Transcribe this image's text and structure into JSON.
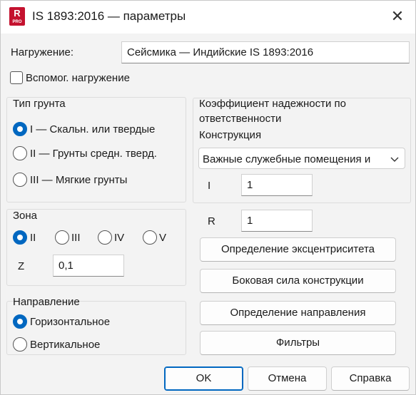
{
  "titlebar": {
    "app_icon_letter": "R",
    "app_icon_sub": "PRO",
    "title": "IS 1893:2016 — параметры",
    "close_symbol": "✕"
  },
  "load": {
    "label": "Нагружение:",
    "value": "Сейсмика — Индийские IS 1893:2016"
  },
  "aux_load": {
    "label": "Вспомог. нагружение",
    "checked": false
  },
  "soil": {
    "title": "Тип грунта",
    "options": [
      {
        "label": "I — Скальн. или твердые",
        "checked": true
      },
      {
        "label": "II — Грунты средн. тверд.",
        "checked": false
      },
      {
        "label": "III — Мягкие грунты",
        "checked": false
      }
    ]
  },
  "zone": {
    "title": "Зона",
    "options": [
      {
        "label": "II",
        "checked": true
      },
      {
        "label": "III",
        "checked": false
      },
      {
        "label": "IV",
        "checked": false
      },
      {
        "label": "V",
        "checked": false
      }
    ],
    "z_label": "Z",
    "z_value": "0,1"
  },
  "direction": {
    "title": "Направление",
    "options": [
      {
        "label": "Горизонтальное",
        "checked": true
      },
      {
        "label": "Вертикальное",
        "checked": false
      }
    ]
  },
  "importance": {
    "title_line1": "Коэффициент надежности по",
    "title_line2": "ответственности",
    "structure_label": "Конструкция",
    "structure_value": "Важные служебные помещения и",
    "i_label": "I",
    "i_value": "1",
    "r_label": "R",
    "r_value": "1"
  },
  "action_buttons": {
    "eccentricity": "Определение эксцентриситета",
    "lateral_force": "Боковая сила конструкции",
    "direction_def": "Определение направления",
    "filters": "Фильтры"
  },
  "footer": {
    "ok": "OK",
    "cancel": "Отмена",
    "help": "Справка"
  }
}
